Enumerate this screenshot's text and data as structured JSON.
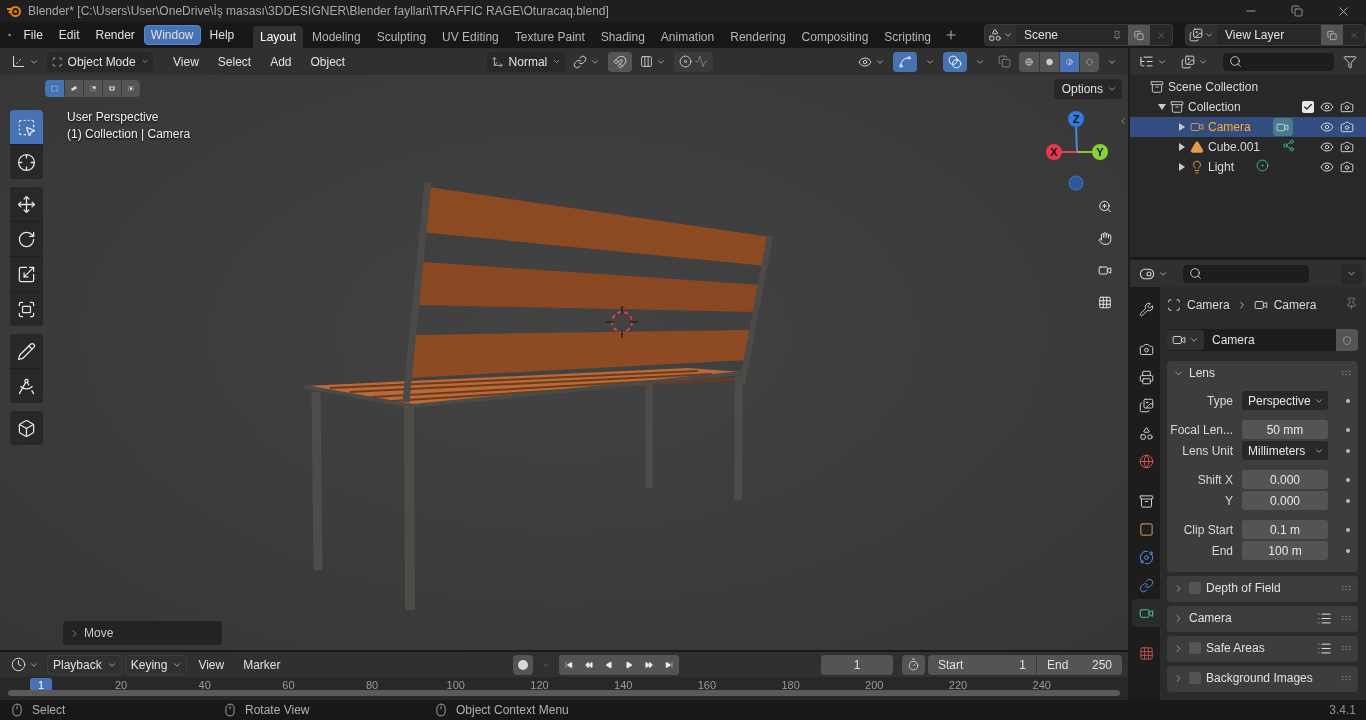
{
  "window": {
    "title": "Blender* [C:\\Users\\User\\OneDrive\\İş masası\\3DDESIGNER\\Blender fayllari\\TRAFFIC RAGE\\Oturacaq.blend]"
  },
  "menus": [
    {
      "label": "File",
      "selected": false
    },
    {
      "label": "Edit",
      "selected": false
    },
    {
      "label": "Render",
      "selected": false
    },
    {
      "label": "Window",
      "selected": true
    },
    {
      "label": "Help",
      "selected": false
    }
  ],
  "workspaces": [
    {
      "label": "Layout",
      "selected": true
    },
    {
      "label": "Modeling",
      "selected": false
    },
    {
      "label": "Sculpting",
      "selected": false
    },
    {
      "label": "UV Editing",
      "selected": false
    },
    {
      "label": "Texture Paint",
      "selected": false
    },
    {
      "label": "Shading",
      "selected": false
    },
    {
      "label": "Animation",
      "selected": false
    },
    {
      "label": "Rendering",
      "selected": false
    },
    {
      "label": "Compositing",
      "selected": false
    },
    {
      "label": "Scripting",
      "selected": false
    }
  ],
  "scene": {
    "name": "Scene"
  },
  "view_layer": {
    "name": "View Layer"
  },
  "viewport": {
    "mode": "Object Mode",
    "menus": [
      "View",
      "Select",
      "Add",
      "Object"
    ],
    "orientation": "Normal",
    "gizmos": {
      "on": true
    },
    "overlays": {
      "on": true
    },
    "xray": {
      "on": false
    },
    "shading": [
      {
        "kind": "wireframe",
        "selected": false
      },
      {
        "kind": "solid",
        "selected": false
      },
      {
        "kind": "material",
        "selected": true
      },
      {
        "kind": "rendered",
        "selected": false
      }
    ],
    "select_modes": [
      {
        "selected": true
      },
      {
        "selected": false
      },
      {
        "selected": false
      },
      {
        "selected": false
      },
      {
        "selected": false
      }
    ],
    "options": "Options",
    "info": [
      "User Perspective",
      "(1) Collection | Camera"
    ],
    "tool_groups": [
      [
        {
          "kind": "select",
          "selected": true
        },
        {
          "kind": "cursor",
          "selected": false
        }
      ],
      [
        {
          "kind": "move",
          "selected": false
        },
        {
          "kind": "rotate",
          "selected": false
        },
        {
          "kind": "scale",
          "selected": false
        },
        {
          "kind": "transform",
          "selected": false
        }
      ],
      [
        {
          "kind": "annotate",
          "selected": false
        },
        {
          "kind": "measure",
          "selected": false
        }
      ],
      [
        {
          "kind": "add_cube",
          "selected": false
        }
      ]
    ],
    "axes": {
      "z": "Z",
      "x": "X",
      "y": "Y"
    },
    "last_operator": "Move"
  },
  "outliner": {
    "tree": [
      {
        "label": "Scene Collection",
        "kind": "scene",
        "selected": false,
        "children": [
          {
            "label": "Collection",
            "kind": "collection",
            "selected": false,
            "expanded": true,
            "checked": true,
            "children": [
              {
                "label": "Camera",
                "kind": "camera",
                "expanded": false,
                "selected": true
              },
              {
                "label": "Cube.001",
                "kind": "mesh",
                "expanded": false,
                "selected": false
              },
              {
                "label": "Light",
                "kind": "light",
                "expanded": false,
                "selected": false
              }
            ]
          }
        ]
      }
    ]
  },
  "properties": {
    "tab_groups": [
      [
        {
          "kind": "tool",
          "selected": false
        }
      ],
      [
        {
          "kind": "render",
          "selected": false
        },
        {
          "kind": "output",
          "selected": false
        },
        {
          "kind": "view_layer",
          "selected": false
        },
        {
          "kind": "scene",
          "selected": false
        },
        {
          "kind": "world",
          "selected": false
        }
      ],
      [
        {
          "kind": "collection",
          "selected": false
        },
        {
          "kind": "object",
          "selected": false
        },
        {
          "kind": "physics",
          "selected": false
        },
        {
          "kind": "constraints",
          "selected": false
        },
        {
          "kind": "data",
          "selected": true
        }
      ],
      [
        {
          "kind": "texture",
          "selected": false
        }
      ]
    ],
    "breadcrumb": [
      "Camera",
      "Camera"
    ],
    "datablock": "Camera",
    "panels": [
      {
        "title": "Lens",
        "expanded": true,
        "kind": "plain",
        "groups": [
          [
            {
              "label": "Type",
              "value": "Perspective",
              "kind": "dropdown"
            }
          ],
          [
            {
              "label": "Focal Len...",
              "value": "50 mm",
              "kind": "number"
            },
            {
              "label": "Lens Unit",
              "value": "Millimeters",
              "kind": "dropdown"
            }
          ],
          [
            {
              "label": "Shift X",
              "value": "0.000",
              "kind": "number"
            },
            {
              "label": "Y",
              "value": "0.000",
              "kind": "number"
            }
          ],
          [
            {
              "label": "Clip Start",
              "value": "0.1 m",
              "kind": "number"
            },
            {
              "label": "End",
              "value": "100 m",
              "kind": "number"
            }
          ]
        ]
      },
      {
        "title": "Depth of Field",
        "expanded": false,
        "kind": "toggle",
        "checked": false
      },
      {
        "title": "Camera",
        "expanded": false,
        "kind": "presets"
      },
      {
        "title": "Safe Areas",
        "expanded": false,
        "kind": "both",
        "checked": false
      },
      {
        "title": "Background Images",
        "expanded": false,
        "kind": "toggle",
        "checked": false
      }
    ]
  },
  "timeline": {
    "menus": [
      {
        "label": "Playback",
        "kind": "dropdown"
      },
      {
        "label": "Keying",
        "kind": "dropdown"
      },
      {
        "label": "View",
        "kind": "menu"
      },
      {
        "label": "Marker",
        "kind": "menu"
      }
    ],
    "auto_key": {
      "on": false
    },
    "current_frame": "1",
    "start_label": "Start",
    "start": "1",
    "end_label": "End",
    "end": "250",
    "playhead": "1",
    "ticks": [
      "20",
      "40",
      "60",
      "80",
      "100",
      "120",
      "140",
      "160",
      "180",
      "200",
      "220",
      "240"
    ]
  },
  "status_bar": {
    "hints": [
      "Select",
      "Rotate View",
      "Object Context Menu"
    ],
    "version": "3.4.1"
  }
}
